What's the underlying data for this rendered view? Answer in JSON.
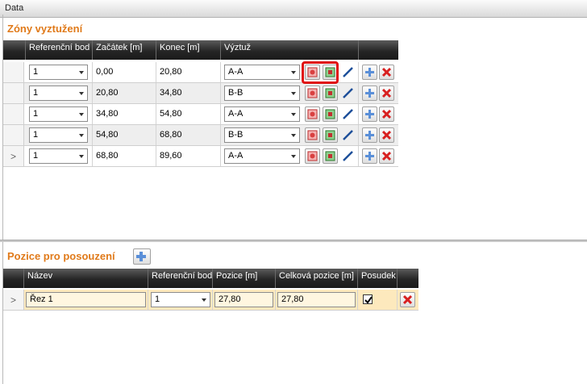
{
  "window": {
    "title": "Data"
  },
  "zones": {
    "title": "Zóny vyztužení",
    "columns": [
      "Referenční bod",
      "Začátek [m]",
      "Konec [m]",
      "Výztuž"
    ],
    "rows": [
      {
        "ref": "1",
        "start": "0,00",
        "end": "20,80",
        "reinf": "A-A"
      },
      {
        "ref": "1",
        "start": "20,80",
        "end": "34,80",
        "reinf": "B-B"
      },
      {
        "ref": "1",
        "start": "34,80",
        "end": "54,80",
        "reinf": "A-A"
      },
      {
        "ref": "1",
        "start": "54,80",
        "end": "68,80",
        "reinf": "B-B"
      },
      {
        "ref": "1",
        "start": "68,80",
        "end": "89,60",
        "reinf": "A-A"
      }
    ]
  },
  "positions": {
    "title": "Pozice pro posouzení",
    "columns": [
      "Název",
      "Referenční bod",
      "Pozice [m]",
      "Celková pozice [m]",
      "Posudek"
    ],
    "rows": [
      {
        "name": "Řez 1",
        "ref": "1",
        "pos": "27,80",
        "total": "27,80",
        "check": true
      }
    ]
  },
  "icons": {
    "reinf_gallery": "red-reinforcement-icon",
    "reinf_import": "green-reinforcement-icon",
    "edit": "pencil-icon",
    "add": "plus-icon",
    "delete": "delete-x-icon"
  },
  "colors": {
    "section_title": "#e07a1a",
    "highlight_row": "#fde9bd",
    "focus_frame": "#e01010"
  }
}
